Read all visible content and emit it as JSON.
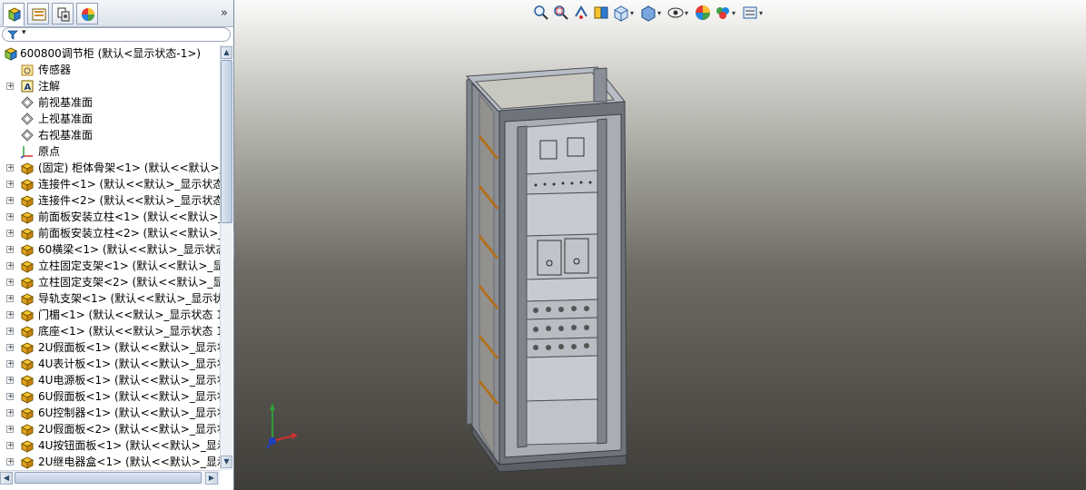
{
  "panel": {
    "tabs": [
      {
        "name": "featuremanager-tab",
        "icon": "feature-tree-icon"
      },
      {
        "name": "propertymanager-tab",
        "icon": "property-manager-icon"
      },
      {
        "name": "configurationmanager-tab",
        "icon": "configuration-manager-icon"
      },
      {
        "name": "displaymanager-tab",
        "icon": "display-manager-icon"
      }
    ],
    "expand_glyph": "»",
    "filter_glyph": "▾",
    "tree": [
      {
        "label": "600800调节柜  (默认<显示状态-1>)",
        "icon": "assembly-icon",
        "expand": false,
        "indent": 0
      },
      {
        "label": "传感器",
        "icon": "sensors-folder-icon",
        "expand": false,
        "indent": 1
      },
      {
        "label": "注解",
        "icon": "annotations-icon",
        "expand": true,
        "indent": 1
      },
      {
        "label": "前视基准面",
        "icon": "plane-icon",
        "expand": false,
        "indent": 1
      },
      {
        "label": "上视基准面",
        "icon": "plane-icon",
        "expand": false,
        "indent": 1
      },
      {
        "label": "右视基准面",
        "icon": "plane-icon",
        "expand": false,
        "indent": 1
      },
      {
        "label": "原点",
        "icon": "origin-icon",
        "expand": false,
        "indent": 1
      },
      {
        "label": "(固定) 柜体骨架<1> (默认<<默认>_显",
        "icon": "subassembly-icon",
        "expand": true,
        "indent": 1
      },
      {
        "label": "连接件<1> (默认<<默认>_显示状态 1",
        "icon": "subassembly-icon",
        "expand": true,
        "indent": 1
      },
      {
        "label": "连接件<2> (默认<<默认>_显示状态 1",
        "icon": "subassembly-icon",
        "expand": true,
        "indent": 1
      },
      {
        "label": "前面板安装立柱<1> (默认<<默认>_显",
        "icon": "subassembly-icon",
        "expand": true,
        "indent": 1
      },
      {
        "label": "前面板安装立柱<2> (默认<<默认>_显",
        "icon": "subassembly-icon",
        "expand": true,
        "indent": 1
      },
      {
        "label": "60横梁<1> (默认<<默认>_显示状态 1",
        "icon": "subassembly-icon",
        "expand": true,
        "indent": 1
      },
      {
        "label": "立柱固定支架<1> (默认<<默认>_显示",
        "icon": "subassembly-icon",
        "expand": true,
        "indent": 1
      },
      {
        "label": "立柱固定支架<2> (默认<<默认>_显示",
        "icon": "subassembly-icon",
        "expand": true,
        "indent": 1
      },
      {
        "label": "导轨支架<1> (默认<<默认>_显示状态",
        "icon": "subassembly-icon",
        "expand": true,
        "indent": 1
      },
      {
        "label": "门楣<1> (默认<<默认>_显示状态 1>)",
        "icon": "subassembly-icon",
        "expand": true,
        "indent": 1
      },
      {
        "label": "底座<1> (默认<<默认>_显示状态 1>)",
        "icon": "subassembly-icon",
        "expand": true,
        "indent": 1
      },
      {
        "label": "2U假面板<1> (默认<<默认>_显示状态",
        "icon": "subassembly-icon",
        "expand": true,
        "indent": 1
      },
      {
        "label": "4U表计板<1> (默认<<默认>_显示状态",
        "icon": "subassembly-icon",
        "expand": true,
        "indent": 1
      },
      {
        "label": "4U电源板<1> (默认<<默认>_显示状态",
        "icon": "subassembly-icon",
        "expand": true,
        "indent": 1
      },
      {
        "label": "6U假面板<1> (默认<<默认>_显示状态",
        "icon": "subassembly-icon",
        "expand": true,
        "indent": 1
      },
      {
        "label": "6U控制器<1> (默认<<默认>_显示状态",
        "icon": "subassembly-icon",
        "expand": true,
        "indent": 1
      },
      {
        "label": "2U假面板<2> (默认<<默认>_显示状态",
        "icon": "subassembly-icon",
        "expand": true,
        "indent": 1
      },
      {
        "label": "4U按钮面板<1> (默认<<默认>_显示状",
        "icon": "subassembly-icon",
        "expand": true,
        "indent": 1
      },
      {
        "label": "2U继电器盒<1> (默认<<默认>_显示状",
        "icon": "subassembly-icon",
        "expand": true,
        "indent": 1
      }
    ],
    "scroll": {
      "up": "▲",
      "down": "▼",
      "left": "◀",
      "right": "▶"
    }
  },
  "heads_up_toolbar": [
    {
      "name": "zoom-to-fit-icon"
    },
    {
      "name": "zoom-to-area-icon"
    },
    {
      "name": "previous-view-icon"
    },
    {
      "name": "section-view-icon"
    },
    {
      "name": "view-orientation-icon",
      "dropdown": true
    },
    {
      "name": "display-style-icon",
      "dropdown": true
    },
    {
      "name": "hide-show-items-icon",
      "dropdown": true
    },
    {
      "name": "edit-appearance-icon"
    },
    {
      "name": "apply-scene-icon",
      "dropdown": true
    },
    {
      "name": "view-settings-icon",
      "dropdown": true
    }
  ],
  "colors": {
    "accent": "#2b5f9e",
    "cabinet": "#cfd3da",
    "frame": "#6b6f78",
    "orange": "#d08a2a"
  }
}
